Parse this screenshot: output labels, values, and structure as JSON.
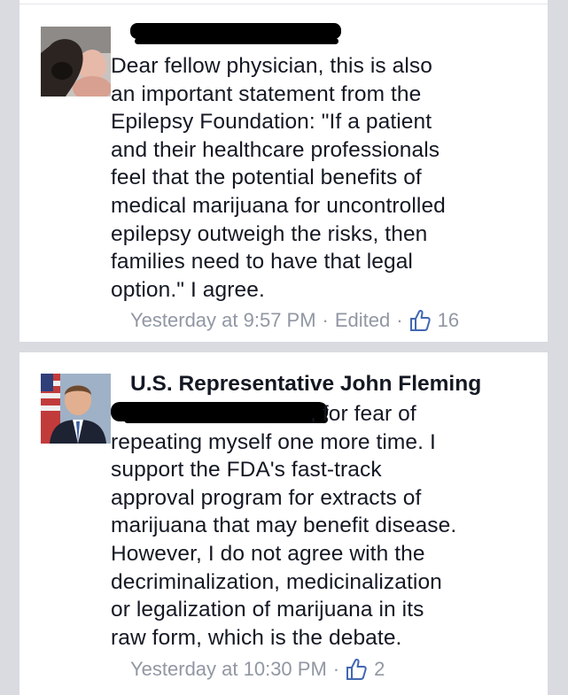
{
  "comments": [
    {
      "author": "",
      "text_lines": [
        "Dear fellow physician, this is also",
        "an important statement from the",
        "Epilepsy Foundation: \"If a patient",
        "and their healthcare professionals",
        "feel that the potential benefits of",
        "medical marijuana for uncontrolled",
        "epilepsy outweigh the risks, then",
        "families need to have that legal",
        "option.\" I agree."
      ],
      "timestamp": "Yesterday at 9:57 PM",
      "edited": "Edited",
      "likes": "16"
    },
    {
      "author": "U.S. Representative John Fleming",
      "first_line_tail": ", for fear of",
      "text_lines": [
        "repeating myself one more time. I",
        "support the FDA's fast-track",
        "approval program for extracts of",
        "marijuana that may benefit disease.",
        "However, I do not agree with the",
        "decriminalization, medicinalization",
        "or legalization of marijuana in its",
        "raw form, which is the debate."
      ],
      "timestamp": "Yesterday at 10:30 PM",
      "likes": "2"
    }
  ],
  "separator": "·",
  "colors": {
    "background": "#d9dbe0",
    "card": "#ffffff",
    "text": "#141823",
    "meta": "#9197a3",
    "like_icon": "#4267b2"
  },
  "icons": {
    "like": "thumbs-up-icon"
  }
}
